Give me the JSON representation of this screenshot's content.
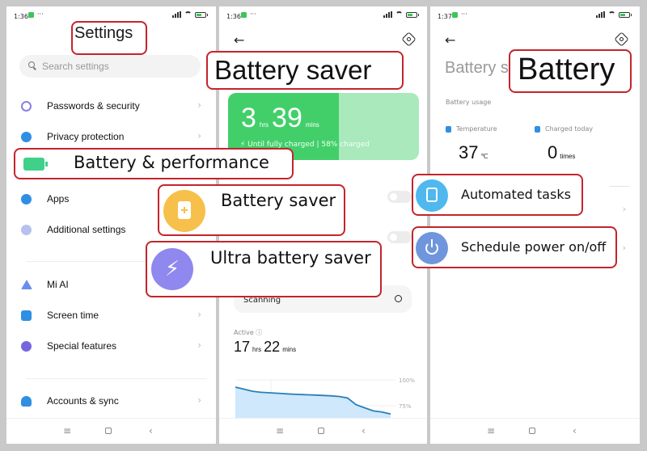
{
  "screens": [
    {
      "status": {
        "time": "1:36",
        "battery_level": 58
      },
      "title": "Settings",
      "search": {
        "placeholder": "Search settings"
      },
      "items": [
        {
          "label": "Passwords & security",
          "icon": "fingerprint-icon",
          "color": "#8a7ee6"
        },
        {
          "label": "Privacy protection",
          "icon": "shield-icon",
          "color": "#2f8fe3"
        },
        {
          "label": "Apps",
          "icon": "gear-icon",
          "color": "#2f8fe3"
        },
        {
          "label": "Additional settings",
          "icon": "more-icon",
          "color": "#9aa8e8"
        },
        {
          "label": "Mi AI",
          "icon": "mi-ai-icon",
          "color": "#6d8cf0"
        },
        {
          "label": "Screen time",
          "icon": "hourglass-icon",
          "color": "#2f8fe3"
        },
        {
          "label": "Special features",
          "icon": "flask-icon",
          "color": "#7566e0"
        },
        {
          "label": "Accounts & sync",
          "icon": "person-icon",
          "color": "#2f8fe3"
        }
      ],
      "highlight": {
        "label": "Battery & performance",
        "icon": "battery-icon",
        "color": "#3fd08a"
      }
    },
    {
      "status": {
        "time": "1:36",
        "battery_level": 58
      },
      "title": "Battery saver",
      "charge_card": {
        "hours": "3",
        "hours_unit": "hrs",
        "minutes": "39",
        "minutes_unit": "mins",
        "subtitle": "⚡ Until fully charged | 58% charged",
        "charged_fraction": 0.58
      },
      "highlights": [
        {
          "label": "Battery saver",
          "icon": "battery-plus-icon",
          "color": "#f6c04a"
        },
        {
          "label": "Ultra battery saver",
          "icon": "lightning-icon",
          "color": "#8f88ee"
        }
      ],
      "scan": {
        "label": "Scanning"
      },
      "active": {
        "label": "Active ⓘ",
        "hours": "17",
        "hours_unit": "hrs",
        "minutes": "22",
        "minutes_unit": "mins"
      },
      "chart_data": {
        "type": "area",
        "title": "",
        "y_tick_labels": [
          "100%",
          "75%"
        ],
        "ylim": [
          65,
          100
        ],
        "x": [
          0,
          1,
          2,
          3,
          4,
          5,
          6,
          7,
          8,
          9,
          10,
          11,
          12,
          13,
          14,
          15,
          16,
          17,
          18
        ],
        "values": [
          93,
          91,
          89,
          88,
          87.5,
          87,
          86.5,
          86,
          85.7,
          85.4,
          85,
          84.6,
          84,
          82.5,
          76,
          73,
          70,
          69,
          67
        ]
      }
    },
    {
      "status": {
        "time": "1:37",
        "battery_level": 58
      },
      "ghost_title": "Battery s",
      "title": "Battery",
      "usage_label": "Battery usage",
      "temperature": {
        "label": "Temperature",
        "value": "37",
        "unit": "℃"
      },
      "charged_today": {
        "label": "Charged today",
        "value": "0",
        "unit": "times"
      },
      "highlights": [
        {
          "label": "Automated tasks",
          "icon": "clipboard-check-icon",
          "color": "#4fb8ee"
        },
        {
          "label": "Schedule power on/off",
          "icon": "power-icon",
          "color": "#6f96dc"
        }
      ]
    }
  ],
  "nav": {
    "menu": "≡",
    "back": "‹"
  }
}
